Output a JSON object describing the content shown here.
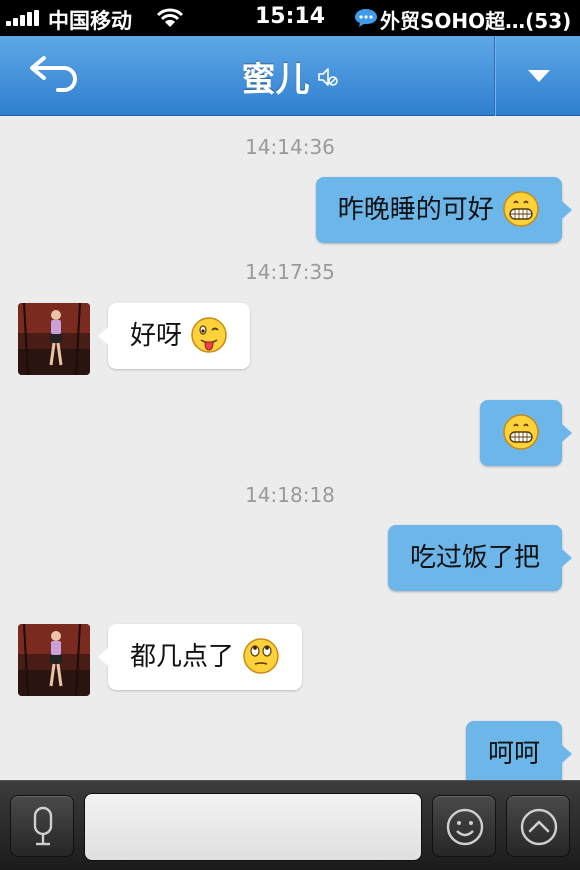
{
  "status_bar": {
    "carrier": "中国移动",
    "time": "15:14",
    "notification": "外贸SOHO超…(53)"
  },
  "nav": {
    "title": "蜜儿",
    "back_icon": "back-arrow-icon",
    "mute_icon": "mute-icon",
    "menu_icon": "dropdown-triangle-icon"
  },
  "messages": [
    {
      "type": "timestamp",
      "text": "14:14:36"
    },
    {
      "type": "outgoing",
      "text": "昨晚睡的可好",
      "emoji": "grin"
    },
    {
      "type": "timestamp",
      "text": "14:17:35"
    },
    {
      "type": "incoming",
      "text": "好呀",
      "emoji": "wink-tongue"
    },
    {
      "type": "outgoing",
      "text": "",
      "emoji": "grin"
    },
    {
      "type": "timestamp",
      "text": "14:18:18"
    },
    {
      "type": "outgoing",
      "text": "吃过饭了把",
      "emoji": ""
    },
    {
      "type": "incoming",
      "text": "都几点了",
      "emoji": "eye-roll"
    },
    {
      "type": "outgoing",
      "text": "呵呵",
      "emoji": ""
    }
  ],
  "input": {
    "value": "",
    "placeholder": ""
  },
  "colors": {
    "nav_top": "#5fa8e6",
    "nav_bottom": "#2f7fd0",
    "outgoing_bubble": "#6cb6ea",
    "incoming_bubble": "#ffffff",
    "background": "#ececec",
    "bottom_bar": "#262626"
  }
}
